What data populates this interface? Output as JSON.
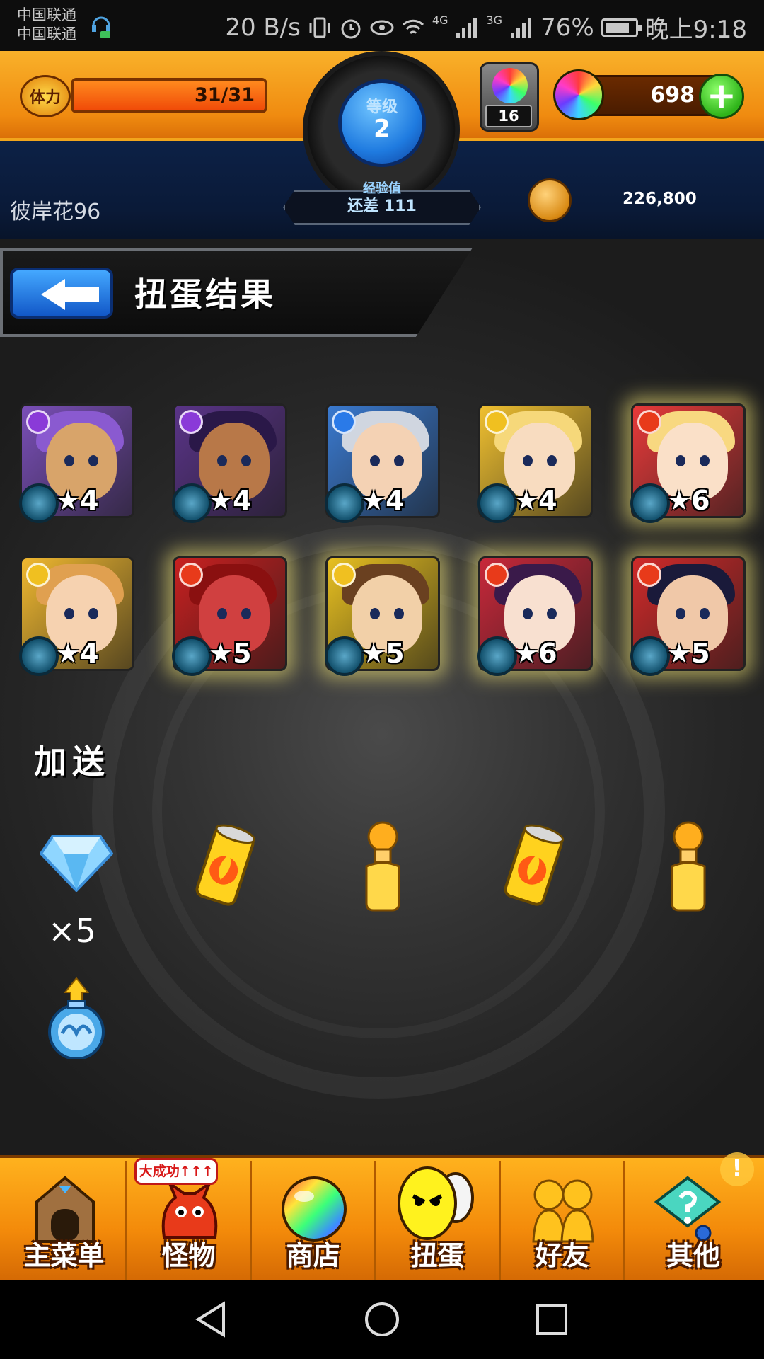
{
  "status_bar": {
    "carrier_1": "中国联通",
    "carrier_2": "中国联通",
    "net_speed": "20 B/s",
    "network_4g": "4G",
    "network_3g": "3G",
    "battery": "76%",
    "time": "晚上9:18"
  },
  "header": {
    "stamina_label": "体力",
    "stamina_value": "31/31",
    "stamina_fraction": 1.0,
    "rank_label": "等级",
    "rank_value": "2",
    "xp_label": "经验值",
    "xp_remaining": "还差 111",
    "orb_stock": "16",
    "gem_count": "698",
    "player_name": "彼岸花96",
    "gold": "226,800"
  },
  "page": {
    "title": "扭蛋结果"
  },
  "results": [
    {
      "stars": "★4",
      "element": "dark",
      "glow": false,
      "bg": "#7a4fb8",
      "hair": "#8a5ad0",
      "skin": "#d8a46a"
    },
    {
      "stars": "★4",
      "element": "dark",
      "glow": false,
      "bg": "#5a3488",
      "hair": "#2a1848",
      "skin": "#b87848"
    },
    {
      "stars": "★4",
      "element": "water",
      "glow": false,
      "bg": "#3a7ad0",
      "hair": "#d0d6e0",
      "skin": "#f4d2b4"
    },
    {
      "stars": "★4",
      "element": "light",
      "glow": false,
      "bg": "#f0c030",
      "hair": "#f6d87a",
      "skin": "#f8dcc0"
    },
    {
      "stars": "★6",
      "element": "fire",
      "glow": true,
      "bg": "#e83a3a",
      "hair": "#f8d880",
      "skin": "#fae0c8"
    },
    {
      "stars": "★4",
      "element": "light",
      "glow": false,
      "bg": "#f0b830",
      "hair": "#e0a050",
      "skin": "#f6d2b0"
    },
    {
      "stars": "★5",
      "element": "fire",
      "glow": true,
      "bg": "#c82020",
      "hair": "#8a1010",
      "skin": "#d04040"
    },
    {
      "stars": "★5",
      "element": "light",
      "glow": true,
      "bg": "#e8c020",
      "hair": "#6a4020",
      "skin": "#f2d0a8"
    },
    {
      "stars": "★6",
      "element": "fire",
      "glow": true,
      "bg": "#c8283a",
      "hair": "#3a1a4a",
      "skin": "#f8e0d0"
    },
    {
      "stars": "★5",
      "element": "fire",
      "glow": true,
      "bg": "#d02a2a",
      "hair": "#1a1a3a",
      "skin": "#f0c8a8"
    }
  ],
  "bonus": {
    "title": "加送",
    "diamond_count": "×5"
  },
  "bottom_nav": [
    {
      "label": "主菜单",
      "icon": "home-gate-icon"
    },
    {
      "label": "怪物",
      "icon": "monster-icon"
    },
    {
      "label": "商店",
      "icon": "rainbow-orb-icon"
    },
    {
      "label": "扭蛋",
      "icon": "gacha-egg-icon"
    },
    {
      "label": "好友",
      "icon": "friends-icon"
    },
    {
      "label": "其他",
      "icon": "other-icon"
    }
  ],
  "promo_tag": "大成功↑↑↑",
  "alert_badge": "!",
  "colors": {
    "header_orange": "#f08b10",
    "header_navy": "#0a1a38",
    "back_button_blue": "#1f7be0",
    "nav_orange": "#f38a0a"
  }
}
